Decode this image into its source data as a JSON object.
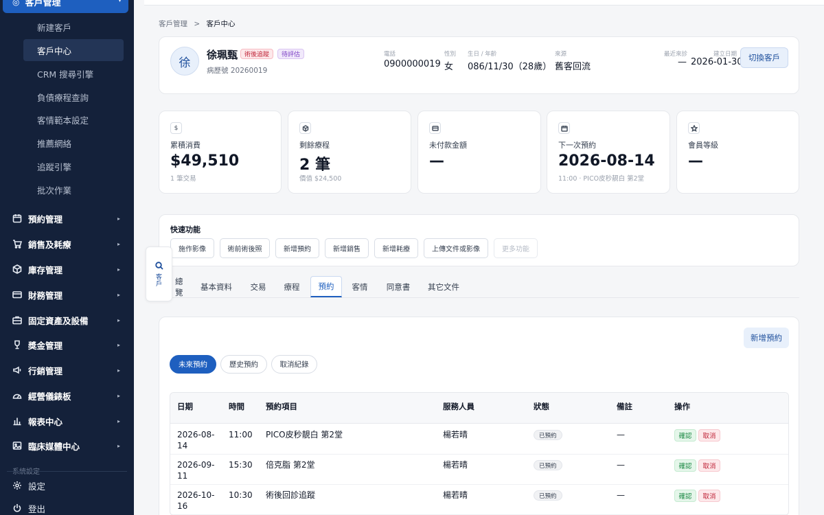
{
  "sidebar": {
    "header": "客戶管理",
    "sub_items": [
      "新建客戶",
      "客戶中心",
      "CRM 搜尋引擎",
      "負債療程查詢",
      "客情範本設定",
      "推薦網絡",
      "追蹤引擎",
      "批次作業"
    ],
    "main_items": [
      {
        "label": "預約管理",
        "icon": "calendar-icon"
      },
      {
        "label": "銷售及耗療",
        "icon": "cart-icon"
      },
      {
        "label": "庫存管理",
        "icon": "box-icon"
      },
      {
        "label": "財務管理",
        "icon": "card-icon"
      },
      {
        "label": "固定資產及設備",
        "icon": "briefcase-icon"
      },
      {
        "label": "獎金管理",
        "icon": "trophy-icon"
      },
      {
        "label": "行銷管理",
        "icon": "megaphone-icon"
      },
      {
        "label": "經營儀錶板",
        "icon": "gauge-icon"
      },
      {
        "label": "報表中心",
        "icon": "bar-chart-icon"
      },
      {
        "label": "臨床媒體中心",
        "icon": "image-icon"
      }
    ],
    "more_label": "系統設定",
    "settings": "設定",
    "logout": "登出"
  },
  "breadcrumb": {
    "parent": "客戶管理",
    "sep": ">",
    "current": "客戶中心"
  },
  "customer": {
    "avatar": "徐",
    "name": "徐珮甄",
    "tags": [
      "術後追蹤",
      "待評估"
    ],
    "chart_no": "病歷號 20260019",
    "phone_label": "電話",
    "phone": "0900000019",
    "gender_label": "性別",
    "gender": "女",
    "birth_label": "生日 / 年齡",
    "birth": "086/11/30（28歲）",
    "source_label": "來源",
    "source": "舊客回流",
    "last_visit_label": "最近來診",
    "last_visit": "—",
    "created_label": "建立日期",
    "created": "2026-01-30",
    "switch_button": "切換客戶"
  },
  "stats": [
    {
      "icon": "$",
      "label": "累積消費",
      "value": "$49,510",
      "sub": "1 筆交易"
    },
    {
      "icon": "cube",
      "label": "剩餘療程",
      "value": "2 筆",
      "sub": "價值 $24,500"
    },
    {
      "icon": "card",
      "label": "未付款金額",
      "value": "—",
      "sub": ""
    },
    {
      "icon": "calendar",
      "label": "下一次預約",
      "value": "2026-08-14",
      "sub": "11:00 · PICO皮秒靚白 第2堂"
    },
    {
      "icon": "star",
      "label": "會員等級",
      "value": "—",
      "sub": ""
    }
  ],
  "quick": {
    "title": "快速功能",
    "buttons": [
      "施作影像",
      "術前術後照",
      "新增預約",
      "新增銷售",
      "新增耗療",
      "上傳文件或影像",
      "更多功能"
    ]
  },
  "float_tab": {
    "label": "客戶"
  },
  "tabs": [
    "總覽",
    "基本資料",
    "交易",
    "療程",
    "預約",
    "客情",
    "同意書",
    "其它文件"
  ],
  "appointments": {
    "new_button": "新增預約",
    "filters": [
      "未來預約",
      "歷史預約",
      "取消紀錄"
    ],
    "columns": [
      "日期",
      "時間",
      "預約項目",
      "服務人員",
      "狀態",
      "備註",
      "操作"
    ],
    "rows": [
      {
        "date": "2026-08-14",
        "time": "11:00",
        "item": "PICO皮秒靚白 第2堂",
        "staff": "楊若晴",
        "status": "已預約",
        "note": "—",
        "confirm": "確認",
        "cancel": "取消"
      },
      {
        "date": "2026-09-11",
        "time": "15:30",
        "item": "倍克脂 第2堂",
        "staff": "楊若晴",
        "status": "已預約",
        "note": "—",
        "confirm": "確認",
        "cancel": "取消"
      },
      {
        "date": "2026-10-16",
        "time": "10:30",
        "item": "術後回診追蹤",
        "staff": "楊若晴",
        "status": "已預約",
        "note": "—",
        "confirm": "確認",
        "cancel": "取消"
      }
    ]
  }
}
